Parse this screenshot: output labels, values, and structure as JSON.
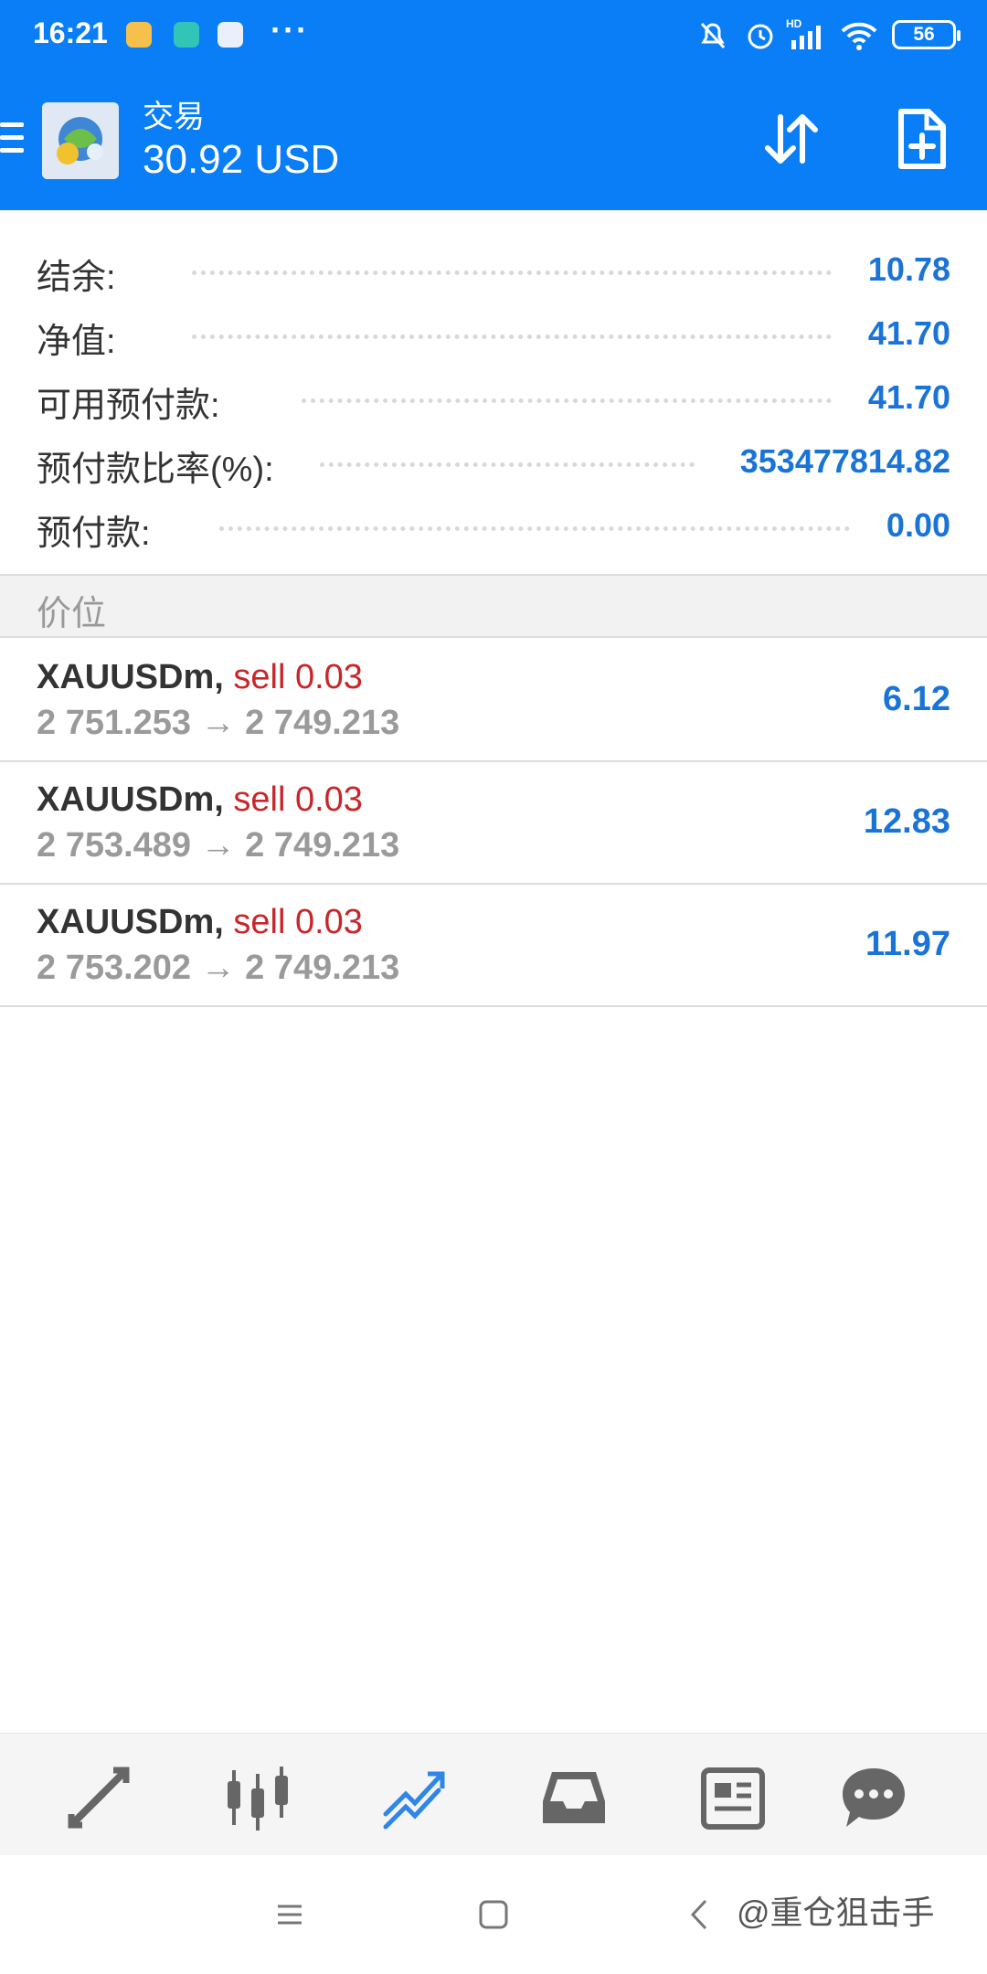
{
  "status_bar": {
    "time": "16:21",
    "more": "···",
    "battery": "56",
    "icons": [
      "chat-app-icon",
      "shield-app-icon",
      "calendar-app-icon",
      "mute-icon",
      "alarm-icon",
      "hd-signal-icon",
      "wifi-icon",
      "battery-icon"
    ]
  },
  "header": {
    "title": "交易",
    "balance": "30.92 USD",
    "icons": [
      "menu-icon",
      "app-logo",
      "sort-icon",
      "new-order-icon"
    ]
  },
  "summary": [
    {
      "label": "结余:",
      "value": "10.78"
    },
    {
      "label": "净值:",
      "value": "41.70"
    },
    {
      "label": "可用预付款:",
      "value": "41.70"
    },
    {
      "label": "预付款比率(%):",
      "value": "353477814.82"
    },
    {
      "label": "预付款:",
      "value": "0.00"
    }
  ],
  "positions_header": "价位",
  "positions": [
    {
      "symbol": "XAUUSDm,",
      "side": "sell 0.03",
      "prices": "2 751.253 → 2 749.213",
      "profit": "6.12"
    },
    {
      "symbol": "XAUUSDm,",
      "side": "sell 0.03",
      "prices": "2 753.489 → 2 749.213",
      "profit": "12.83"
    },
    {
      "symbol": "XAUUSDm,",
      "side": "sell 0.03",
      "prices": "2 753.202 → 2 749.213",
      "profit": "11.97"
    }
  ],
  "bottom_tabs": [
    "quotes-tab-icon",
    "chart-tab-icon",
    "trade-tab-icon",
    "history-tab-icon",
    "news-tab-icon",
    "messages-tab-icon"
  ],
  "active_tab": "trade-tab-icon",
  "watermark": "@重仓狙击手",
  "colors": {
    "accent": "#0a7ef7",
    "value_blue": "#1a73d6",
    "sell_red": "#c8262b"
  }
}
